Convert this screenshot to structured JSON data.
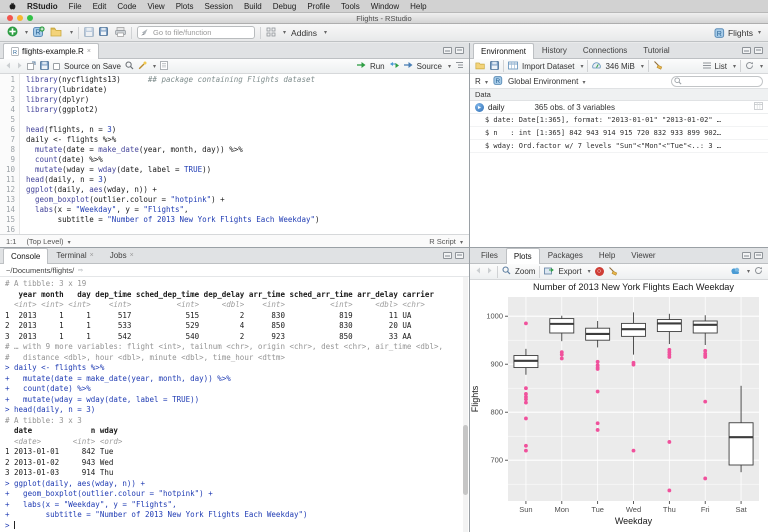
{
  "menu_bar": {
    "items": [
      "RStudio",
      "File",
      "Edit",
      "Code",
      "View",
      "Plots",
      "Session",
      "Build",
      "Debug",
      "Profile",
      "Tools",
      "Window",
      "Help"
    ]
  },
  "title_bar": {
    "title": "Flights - RStudio"
  },
  "main_toolbar": {
    "goto_placeholder": "Go to file/function",
    "addins_label": "Addins",
    "project_label": "Flights"
  },
  "source_pane": {
    "tab_label": "flights-example.R",
    "toolbar": {
      "source_on_save": "Source on Save",
      "run": "Run",
      "source": "Source"
    },
    "status": {
      "position": "1:1",
      "scope": "(Top Level)",
      "type": "R Script"
    },
    "code_lines": [
      [
        [
          "f",
          "library"
        ],
        [
          "p",
          "(nycflights13)"
        ],
        [
          "c",
          "      ## package containing Flights dataset"
        ]
      ],
      [
        [
          "f",
          "library"
        ],
        [
          "p",
          "(lubridate)"
        ]
      ],
      [
        [
          "f",
          "library"
        ],
        [
          "p",
          "(dplyr)"
        ]
      ],
      [
        [
          "f",
          "library"
        ],
        [
          "p",
          "(ggplot2)"
        ]
      ],
      [],
      [
        [
          "f",
          "head"
        ],
        [
          "p",
          "(flights, n = "
        ],
        [
          "n",
          "3"
        ],
        [
          "p",
          ")"
        ]
      ],
      [
        [
          "p",
          "daily <- flights %>%"
        ]
      ],
      [
        [
          "p",
          "  "
        ],
        [
          "f",
          "mutate"
        ],
        [
          "p",
          "(date = "
        ],
        [
          "f",
          "make_date"
        ],
        [
          "p",
          "(year, month, day)) %>%"
        ]
      ],
      [
        [
          "p",
          "  "
        ],
        [
          "f",
          "count"
        ],
        [
          "p",
          "(date) %>%"
        ]
      ],
      [
        [
          "p",
          "  "
        ],
        [
          "f",
          "mutate"
        ],
        [
          "p",
          "(wday = "
        ],
        [
          "f",
          "wday"
        ],
        [
          "p",
          "(date, label = "
        ],
        [
          "n",
          "TRUE"
        ],
        [
          "p",
          "))"
        ]
      ],
      [
        [
          "f",
          "head"
        ],
        [
          "p",
          "(daily, n = "
        ],
        [
          "n",
          "3"
        ],
        [
          "p",
          ")"
        ]
      ],
      [
        [
          "f",
          "ggplot"
        ],
        [
          "p",
          "(daily, "
        ],
        [
          "f",
          "aes"
        ],
        [
          "p",
          "(wday, n)) +"
        ]
      ],
      [
        [
          "p",
          "  "
        ],
        [
          "f",
          "geom_boxplot"
        ],
        [
          "p",
          "(outlier.colour = "
        ],
        [
          "s",
          "\"hotpink\""
        ],
        [
          "p",
          ") +"
        ]
      ],
      [
        [
          "p",
          "  "
        ],
        [
          "f",
          "labs"
        ],
        [
          "p",
          "(x = "
        ],
        [
          "s",
          "\"Weekday\""
        ],
        [
          "p",
          ", y = "
        ],
        [
          "s",
          "\"Flights\""
        ],
        [
          "p",
          ","
        ]
      ],
      [
        [
          "p",
          "       subtitle = "
        ],
        [
          "s",
          "\"Number of 2013 New York Flights Each Weekday\""
        ],
        [
          "p",
          ")"
        ]
      ],
      []
    ]
  },
  "console_pane": {
    "tabs": [
      "Console",
      "Terminal",
      "Jobs"
    ],
    "active_tab": "Console",
    "path": "~/Documents/flights/",
    "lines": [
      {
        "c": "meta",
        "t": "# A tibble: 3 x 19"
      },
      {
        "c": "hd",
        "t": "   year month   day dep_time sched_dep_time dep_delay arr_time sched_arr_time arr_delay carrier"
      },
      {
        "c": "type",
        "t": "  <int> <int> <int>    <int>          <int>     <dbl>    <int>          <int>     <dbl> <chr>"
      },
      {
        "c": "out",
        "t": "1  2013     1     1      517            515         2      830            819        11 UA"
      },
      {
        "c": "out",
        "t": "2  2013     1     1      533            529         4      850            830        20 UA"
      },
      {
        "c": "out",
        "t": "3  2013     1     1      542            540         2      923            850        33 AA"
      },
      {
        "c": "meta",
        "t": "# … with 9 more variables: flight <int>, tailnum <chr>, origin <chr>, dest <chr>, air_time <dbl>,"
      },
      {
        "c": "meta",
        "t": "#   distance <dbl>, hour <dbl>, minute <dbl>, time_hour <dttm>"
      },
      {
        "c": "in",
        "t": "> daily <- flights %>%"
      },
      {
        "c": "in",
        "t": "+   mutate(date = make_date(year, month, day)) %>%"
      },
      {
        "c": "in",
        "t": "+   count(date) %>%"
      },
      {
        "c": "in",
        "t": "+   mutate(wday = wday(date, label = TRUE))"
      },
      {
        "c": "in",
        "t": "> head(daily, n = 3)"
      },
      {
        "c": "meta",
        "t": "# A tibble: 3 x 3"
      },
      {
        "c": "hd",
        "t": "  date             n wday"
      },
      {
        "c": "type",
        "t": "  <date>       <int> <ord>"
      },
      {
        "c": "out",
        "t": "1 2013-01-01     842 Tue"
      },
      {
        "c": "out",
        "t": "2 2013-01-02     943 Wed"
      },
      {
        "c": "out",
        "t": "3 2013-01-03     914 Thu"
      },
      {
        "c": "in",
        "t": "> ggplot(daily, aes(wday, n)) +"
      },
      {
        "c": "in",
        "t": "+   geom_boxplot(outlier.colour = \"hotpink\") +"
      },
      {
        "c": "in",
        "t": "+   labs(x = \"Weekday\", y = \"Flights\","
      },
      {
        "c": "in",
        "t": "+        subtitle = \"Number of 2013 New York Flights Each Weekday\")"
      },
      {
        "c": "in",
        "t": "> ",
        "prompt": true
      }
    ]
  },
  "environment_pane": {
    "tabs": [
      "Environment",
      "History",
      "Connections",
      "Tutorial"
    ],
    "active_tab": "Environment",
    "toolbar": {
      "import_dataset": "Import Dataset",
      "memory": "346 MiB",
      "list": "List"
    },
    "scope_bar": {
      "language": "R",
      "environment": "Global Environment"
    },
    "section_label": "Data",
    "objects": [
      {
        "name": "daily",
        "summary": "365 obs. of 3 variables"
      }
    ],
    "fields": [
      "$ date: Date[1:365], format: \"2013-01-01\" \"2013-01-02\" …",
      "$ n   : int [1:365] 842 943 914 915 720 832 933 899 902…",
      "$ wday: Ord.factor w/ 7 levels \"Sun\"<\"Mon\"<\"Tue\"<..: 3 …"
    ]
  },
  "plots_pane": {
    "tabs": [
      "Files",
      "Plots",
      "Packages",
      "Help",
      "Viewer"
    ],
    "active_tab": "Plots",
    "toolbar": {
      "zoom": "Zoom",
      "export": "Export"
    }
  },
  "chart_data": {
    "type": "boxplot",
    "title": "Number of 2013 New York Flights Each Weekday",
    "xlabel": "Weekday",
    "ylabel": "Flights",
    "categories": [
      "Sun",
      "Mon",
      "Tue",
      "Wed",
      "Thu",
      "Fri",
      "Sat"
    ],
    "yticks": [
      700,
      800,
      900,
      1000
    ],
    "minor_ticks": [
      650,
      750,
      850,
      950
    ],
    "ylim": [
      615,
      1040
    ],
    "panel_bg": "#ebebeb",
    "grid_color": "#ffffff",
    "box_color": "#3c3c3c",
    "outlier_color": "#f0519c",
    "series": [
      {
        "category": "Sun",
        "whisker_low": 878,
        "q1": 893,
        "median": 907,
        "q3": 918,
        "whisker_high": 932,
        "outliers": [
          985,
          850,
          838,
          832,
          827,
          820,
          787,
          730,
          720
        ]
      },
      {
        "category": "Mon",
        "whisker_low": 948,
        "q1": 965,
        "median": 984,
        "q3": 995,
        "whisker_high": 1001,
        "outliers": [
          925,
          920,
          912
        ]
      },
      {
        "category": "Tue",
        "whisker_low": 935,
        "q1": 950,
        "median": 963,
        "q3": 975,
        "whisker_high": 990,
        "outliers": [
          905,
          898,
          893,
          890,
          843,
          777,
          763
        ]
      },
      {
        "category": "Wed",
        "whisker_low": 920,
        "q1": 958,
        "median": 973,
        "q3": 985,
        "whisker_high": 1008,
        "outliers": [
          903,
          899,
          720
        ]
      },
      {
        "category": "Thu",
        "whisker_low": 942,
        "q1": 968,
        "median": 985,
        "q3": 993,
        "whisker_high": 1005,
        "outliers": [
          930,
          925,
          920,
          915,
          738,
          637
        ]
      },
      {
        "category": "Fri",
        "whisker_low": 940,
        "q1": 965,
        "median": 982,
        "q3": 990,
        "whisker_high": 1002,
        "outliers": [
          928,
          922,
          918,
          915,
          822,
          662
        ]
      },
      {
        "category": "Sat",
        "whisker_low": 675,
        "q1": 690,
        "median": 748,
        "q3": 778,
        "whisker_high": 855,
        "outliers": []
      }
    ]
  }
}
